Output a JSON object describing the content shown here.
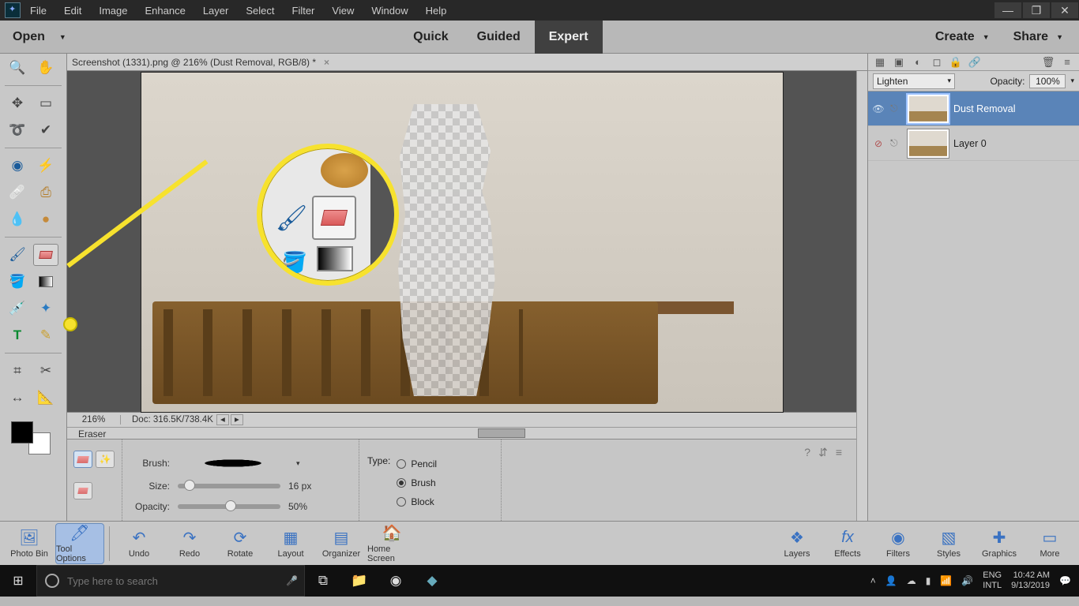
{
  "menu": {
    "items": [
      "File",
      "Edit",
      "Image",
      "Enhance",
      "Layer",
      "Select",
      "Filter",
      "View",
      "Window",
      "Help"
    ]
  },
  "appbar": {
    "open": "Open",
    "modes": {
      "quick": "Quick",
      "guided": "Guided",
      "expert": "Expert"
    },
    "create": "Create",
    "share": "Share"
  },
  "document": {
    "tab_title": "Screenshot (1331).png @ 216% (Dust Removal, RGB/8) *",
    "zoom": "216%",
    "doc_info": "Doc: 316.5K/738.4K"
  },
  "tool_options": {
    "title": "Eraser",
    "brush_label": "Brush:",
    "size_label": "Size:",
    "size_value": "16 px",
    "opacity_label": "Opacity:",
    "opacity_value": "50%",
    "type_label": "Type:",
    "type_options": {
      "pencil": "Pencil",
      "brush": "Brush",
      "block": "Block"
    },
    "type_selected": "brush"
  },
  "layers_panel": {
    "blend_mode": "Lighten",
    "opacity_label": "Opacity:",
    "opacity_value": "100%",
    "layers": [
      {
        "name": "Dust Removal",
        "visible": true
      },
      {
        "name": "Layer 0",
        "visible": false
      }
    ]
  },
  "bottom_actions": {
    "photo_bin": "Photo Bin",
    "tool_options": "Tool Options",
    "undo": "Undo",
    "redo": "Redo",
    "rotate": "Rotate",
    "layout": "Layout",
    "organizer": "Organizer",
    "home": "Home Screen",
    "layers": "Layers",
    "effects": "Effects",
    "filters": "Filters",
    "styles": "Styles",
    "graphics": "Graphics",
    "more": "More"
  },
  "taskbar": {
    "search_placeholder": "Type here to search",
    "lang1": "ENG",
    "lang2": "INTL",
    "time": "10:42 AM",
    "date": "9/13/2019"
  }
}
